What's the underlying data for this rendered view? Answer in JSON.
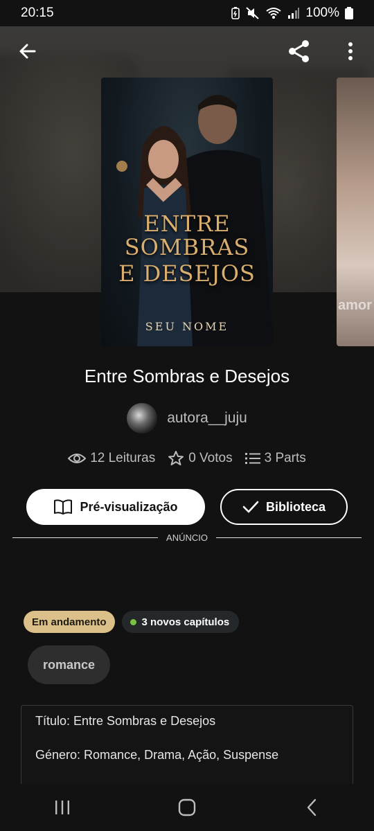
{
  "status_bar": {
    "time": "20:15",
    "battery": "100%"
  },
  "cover": {
    "title_line1": "ENTRE",
    "title_line2": "SOMBRAS",
    "title_line3": "E DESEJOS",
    "author": "SEU NOME"
  },
  "next_cover": {
    "text": "amor"
  },
  "story": {
    "title": "Entre Sombras e Desejos",
    "author": "autora__juju",
    "reads": "12 Leituras",
    "votes": "0 Votos",
    "parts": "3 Parts"
  },
  "buttons": {
    "preview": "Pré-visualização",
    "library": "Biblioteca"
  },
  "ad_label": "ANÚNCIO",
  "badges": {
    "status": "Em andamento",
    "new_chapters": "3 novos capítulos"
  },
  "tag": "romance",
  "description": {
    "line1": "Título: Entre Sombras e Desejos",
    "line2": "Género: Romance, Drama, Ação, Suspense"
  },
  "colors": {
    "status_badge": "#dcc08a",
    "new_dot": "#7cc242",
    "cover_title": "#d9ae6e"
  }
}
